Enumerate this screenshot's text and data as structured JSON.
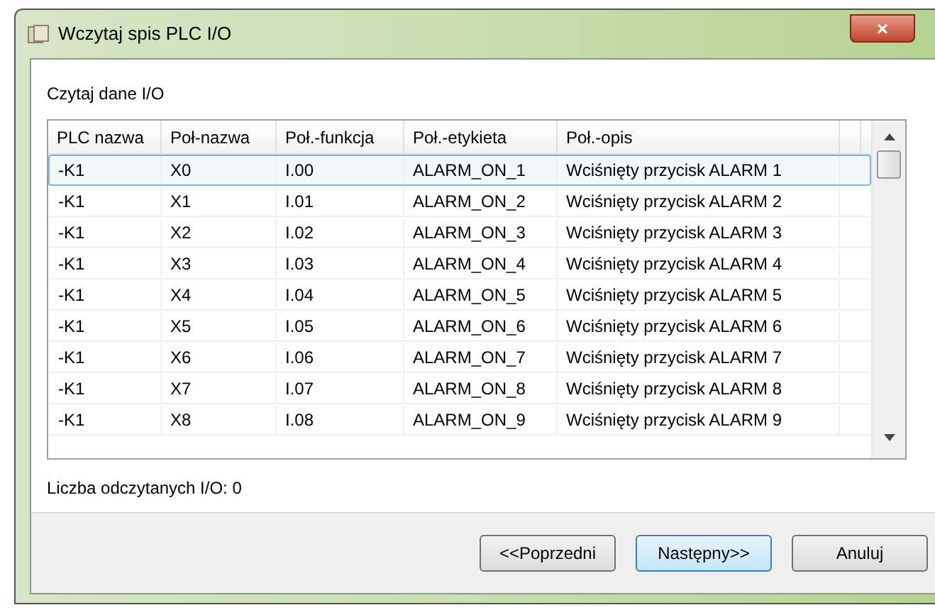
{
  "window": {
    "title": "Wczytaj spis PLC I/O",
    "close": "×"
  },
  "section_title": "Czytaj dane I/O",
  "table": {
    "columns": [
      "PLC nazwa",
      "Poł-nazwa",
      "Poł.-funkcja",
      "Poł.-etykieta",
      "Poł.-opis"
    ],
    "rows": [
      {
        "cells": [
          "-K1",
          "X0",
          "I.00",
          "ALARM_ON_1",
          "Wciśnięty przycisk ALARM 1"
        ],
        "selected": true
      },
      {
        "cells": [
          "-K1",
          "X1",
          "I.01",
          "ALARM_ON_2",
          "Wciśnięty przycisk ALARM 2"
        ],
        "selected": false
      },
      {
        "cells": [
          "-K1",
          "X2",
          "I.02",
          "ALARM_ON_3",
          "Wciśnięty przycisk ALARM 3"
        ],
        "selected": false
      },
      {
        "cells": [
          "-K1",
          "X3",
          "I.03",
          "ALARM_ON_4",
          "Wciśnięty przycisk ALARM 4"
        ],
        "selected": false
      },
      {
        "cells": [
          "-K1",
          "X4",
          "I.04",
          "ALARM_ON_5",
          "Wciśnięty przycisk ALARM 5"
        ],
        "selected": false
      },
      {
        "cells": [
          "-K1",
          "X5",
          "I.05",
          "ALARM_ON_6",
          "Wciśnięty przycisk ALARM 6"
        ],
        "selected": false
      },
      {
        "cells": [
          "-K1",
          "X6",
          "I.06",
          "ALARM_ON_7",
          "Wciśnięty przycisk ALARM 7"
        ],
        "selected": false
      },
      {
        "cells": [
          "-K1",
          "X7",
          "I.07",
          "ALARM_ON_8",
          "Wciśnięty przycisk ALARM 8"
        ],
        "selected": false
      },
      {
        "cells": [
          "-K1",
          "X8",
          "I.08",
          "ALARM_ON_9",
          "Wciśnięty przycisk ALARM 9"
        ],
        "selected": false
      }
    ]
  },
  "status": "Liczba odczytanych I/O: 0",
  "buttons": [
    {
      "label": "<<Poprzedni",
      "default": false
    },
    {
      "label": "Następny>>",
      "default": true
    },
    {
      "label": "Anuluj",
      "default": false
    }
  ]
}
